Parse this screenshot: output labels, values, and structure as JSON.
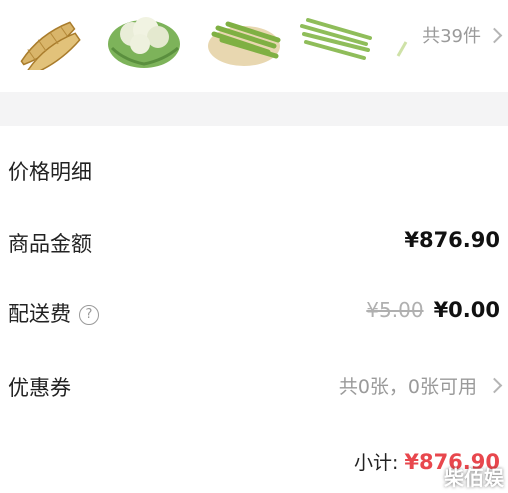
{
  "goods": {
    "items": [
      {
        "icon": "bamboo-shoot-icon"
      },
      {
        "icon": "cauliflower-icon"
      },
      {
        "icon": "green-beans-icon"
      },
      {
        "icon": "long-beans-icon"
      }
    ],
    "count_label": "共39件"
  },
  "price_detail": {
    "title": "价格明细",
    "goods_amount": {
      "label": "商品金额",
      "value": "¥876.90"
    },
    "shipping": {
      "label": "配送费",
      "help_symbol": "?",
      "original": "¥5.00",
      "value": "¥0.00"
    },
    "coupon": {
      "label": "优惠券",
      "status": "共0张，0张可用"
    },
    "subtotal": {
      "label": "小计:",
      "value": "¥876.90"
    }
  },
  "watermark": "柴佰娱",
  "colors": {
    "accent_red": "#e8474d",
    "muted": "#9a9a9a",
    "section_bg": "#f4f4f5"
  }
}
